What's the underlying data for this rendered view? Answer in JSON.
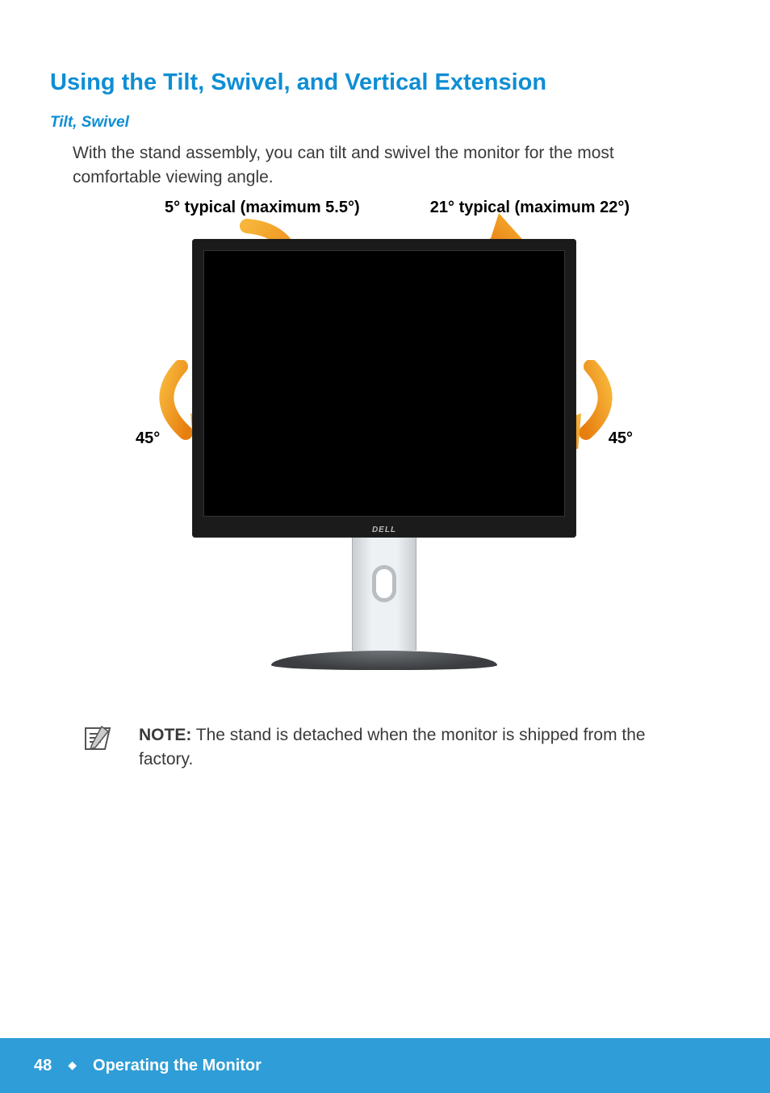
{
  "heading": "Using the Tilt, Swivel, and Vertical Extension",
  "subheading": "Tilt, Swivel",
  "intro": "With the stand assembly, you can tilt and swivel the monitor for the most comfortable viewing angle.",
  "diagram": {
    "tilt_back_label": "5° typical (maximum 5.5°)",
    "tilt_fwd_label": "21° typical (maximum 22°)",
    "swivel_left_label": "45°",
    "swivel_right_label": "45°",
    "brand": "DELL"
  },
  "note": {
    "label": "NOTE:",
    "text": " The stand  is detached when the monitor is shipped from the factory."
  },
  "footer": {
    "page_number": "48",
    "section": "Operating the Monitor"
  },
  "colors": {
    "accent": "#0e8ed4",
    "arrow": "#f29b1b",
    "footer": "#2f9dd7"
  }
}
